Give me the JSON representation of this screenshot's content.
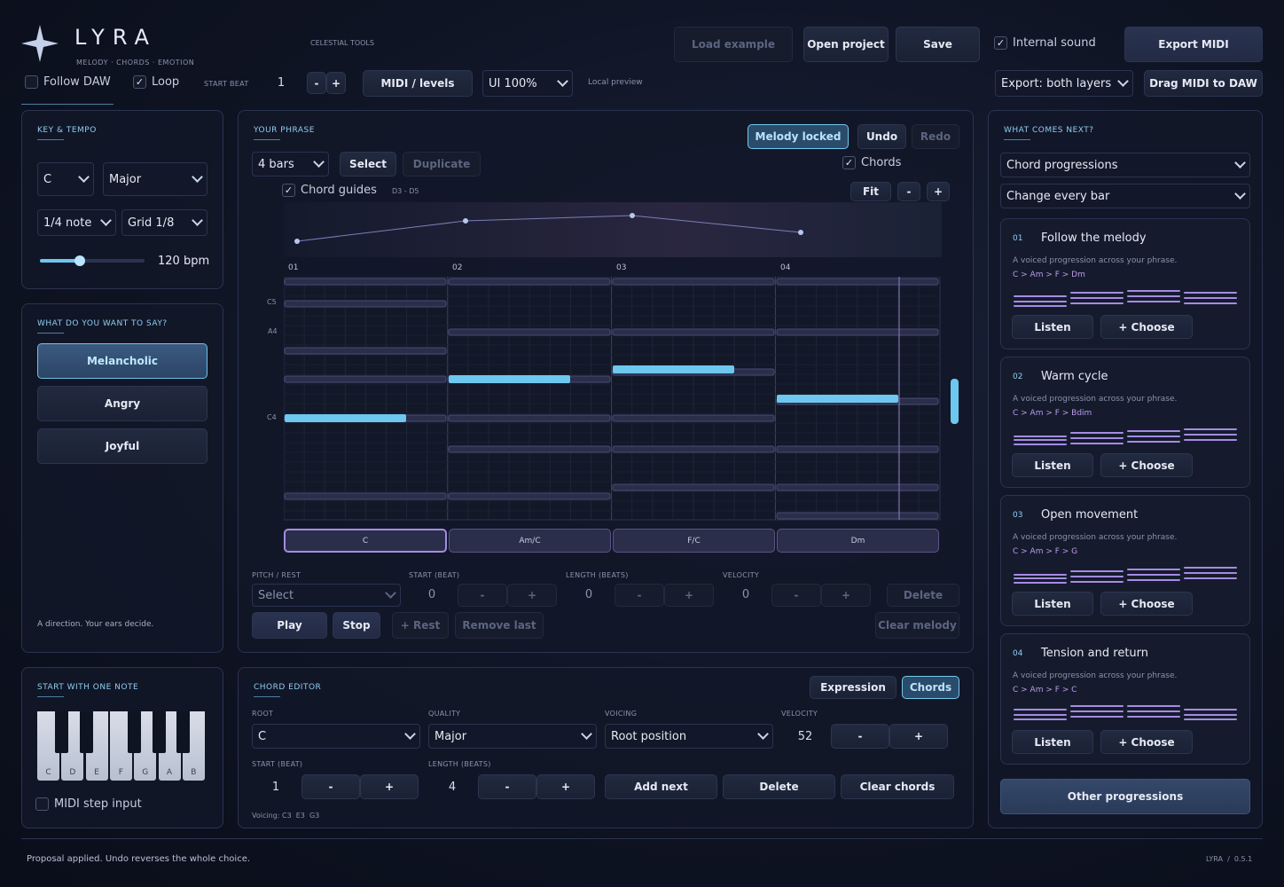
{
  "brand": {
    "name": "LYRA",
    "tagline": "MELODY · CHORDS · EMOTION",
    "section": "CELESTIAL TOOLS"
  },
  "topbar": {
    "load_example": "Load example",
    "open_project": "Open project",
    "save": "Save",
    "internal_sound": "Internal sound",
    "export_midi": "Export MIDI",
    "follow_daw": "Follow DAW",
    "loop": "Loop",
    "start_beat_label": "START BEAT",
    "start_beat_value": "1",
    "minus": "-",
    "plus": "+",
    "midi_levels": "MIDI / levels",
    "ui_scale": "UI 100%",
    "local_preview": "Local preview",
    "export_layers": "Export: both layers",
    "drag_midi": "Drag MIDI to DAW",
    "internal_sound_checked": true,
    "loop_checked": true,
    "follow_daw_checked": false
  },
  "key_tempo": {
    "title": "KEY & TEMPO",
    "key": "C",
    "mode": "Major",
    "note_value": "1/4 note",
    "grid": "Grid 1/8",
    "bpm": "120 bpm",
    "tempo_fraction": 0.38
  },
  "emotion": {
    "title": "WHAT DO YOU WANT TO SAY?",
    "options": [
      "Melancholic",
      "Angry",
      "Joyful"
    ],
    "selected": "Melancholic",
    "hint": "A direction. Your ears decide."
  },
  "start_note": {
    "title": "START WITH ONE NOTE",
    "keys": [
      "C",
      "D",
      "E",
      "F",
      "G",
      "A",
      "B"
    ],
    "midi_step": "MIDI step input"
  },
  "phrase": {
    "title": "YOUR PHRASE",
    "melody_locked": "Melody locked",
    "undo": "Undo",
    "redo": "Redo",
    "bars": "4 bars",
    "select": "Select",
    "duplicate": "Duplicate",
    "chords_toggle": "Chords",
    "chord_guides": "Chord guides",
    "range": "D3 - D5",
    "fit": "Fit",
    "minus": "-",
    "plus": "+",
    "bar_numbers": [
      "01",
      "02",
      "03",
      "04"
    ],
    "pitch_labels": [
      "C5",
      "A4",
      "C4"
    ],
    "chords": [
      "C",
      "Am/C",
      "F/C",
      "Dm"
    ],
    "pitch_rest_label": "PITCH / REST",
    "pitch_rest_value": "Select",
    "start_label": "START (BEAT)",
    "start_value": "0",
    "length_label": "LENGTH (BEATS)",
    "length_value": "0",
    "velocity_label": "VELOCITY",
    "velocity_value": "0",
    "delete": "Delete",
    "play": "Play",
    "stop": "Stop",
    "rest": "+ Rest",
    "remove_last": "Remove last",
    "clear_melody": "Clear melody"
  },
  "chord_editor": {
    "title": "CHORD EDITOR",
    "expression": "Expression",
    "chords": "Chords",
    "root_label": "ROOT",
    "root": "C",
    "quality_label": "QUALITY",
    "quality": "Major",
    "voicing_label": "VOICING",
    "voicing": "Root position",
    "velocity_label": "VELOCITY",
    "velocity": "52",
    "start_label": "START (BEAT)",
    "start": "1",
    "length_label": "LENGTH (BEATS)",
    "length": "4",
    "add_next": "Add next",
    "delete": "Delete",
    "clear_chords": "Clear chords",
    "voicing_notes": "Voicing: C3  E3  G3",
    "minus": "-",
    "plus": "+"
  },
  "next": {
    "title": "WHAT COMES NEXT?",
    "type": "Chord progressions",
    "rate": "Change every bar",
    "listen": "Listen",
    "choose": "+ Choose",
    "cards": [
      {
        "num": "01",
        "title": "Follow the melody",
        "desc": "A voiced progression across your phrase.",
        "prog": "C > Am > F > Dm"
      },
      {
        "num": "02",
        "title": "Warm cycle",
        "desc": "A voiced progression across your phrase.",
        "prog": "C > Am > F > Bdim"
      },
      {
        "num": "03",
        "title": "Open movement",
        "desc": "A voiced progression across your phrase.",
        "prog": "C > Am > F > G"
      },
      {
        "num": "04",
        "title": "Tension and return",
        "desc": "A voiced progression across your phrase.",
        "prog": "C > Am > F > C"
      }
    ],
    "other": "Other progressions"
  },
  "status": {
    "message": "Proposal applied. Undo reverses the whole choice.",
    "version": "LYRA  /  0.5.1"
  },
  "colors": {
    "accent": "#73c8ef",
    "chord_line": "#a58be2",
    "note": "#6ec7ee"
  }
}
